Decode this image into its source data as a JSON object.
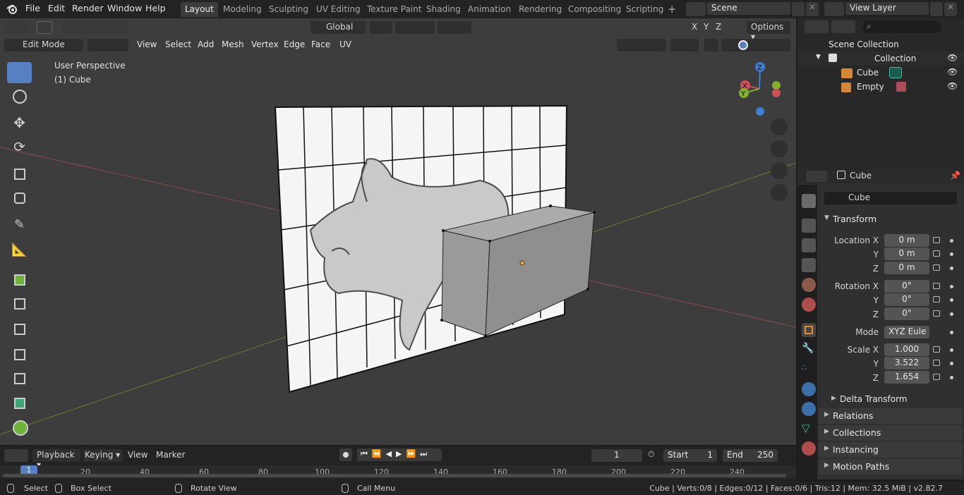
{
  "topbar": {
    "menus": [
      "File",
      "Edit",
      "Render",
      "Window",
      "Help"
    ],
    "workspaces": [
      "Layout",
      "Modeling",
      "Sculpting",
      "UV Editing",
      "Texture Paint",
      "Shading",
      "Animation",
      "Rendering",
      "Compositing",
      "Scripting"
    ],
    "active_workspace": "Layout",
    "add_label": "+",
    "scene": "Scene",
    "view_layer": "View Layer"
  },
  "viewport": {
    "transform_orientation": "Global",
    "options_label": "Options",
    "mode": "Edit Mode",
    "menus": [
      "View",
      "Select",
      "Add",
      "Mesh",
      "Vertex",
      "Edge",
      "Face",
      "UV"
    ],
    "overlay_title": "User Perspective",
    "overlay_object": "(1) Cube",
    "axes": {
      "x": "X",
      "y": "Y",
      "z": "Z"
    }
  },
  "outliner": {
    "root": "Scene Collection",
    "collection": "Collection",
    "items": [
      "Cube",
      "Empty"
    ]
  },
  "properties": {
    "object_name": "Cube",
    "data_name": "Cube",
    "transform": {
      "title": "Transform",
      "location_label": "Location X",
      "location": [
        "0 m",
        "0 m",
        "0 m"
      ],
      "rotation_label": "Rotation X",
      "rotation": [
        "0°",
        "0°",
        "0°"
      ],
      "mode_label": "Mode",
      "mode": "XYZ Eule",
      "scale_label": "Scale X",
      "scale": [
        "1.000",
        "3.522",
        "1.654"
      ],
      "y_label": "Y",
      "z_label": "Z"
    },
    "delta": "Delta Transform",
    "panels": [
      "Relations",
      "Collections",
      "Instancing",
      "Motion Paths"
    ]
  },
  "timeline": {
    "menus": [
      "Playback",
      "Keying",
      "View",
      "Marker"
    ],
    "current_frame": "1",
    "start_label": "Start",
    "start": "1",
    "end_label": "End",
    "end": "250",
    "ticks": [
      "1",
      "20",
      "40",
      "60",
      "80",
      "100",
      "120",
      "140",
      "160",
      "180",
      "200",
      "220",
      "240"
    ]
  },
  "statusbar": {
    "select": "Select",
    "box_select": "Box Select",
    "rotate": "Rotate View",
    "call_menu": "Call Menu",
    "stats": "Cube | Verts:0/8 | Edges:0/12 | Faces:0/6 | Tris:12 | Mem: 32.5 MiB | v2.82.7"
  },
  "colors": {
    "accent": "#5680c2",
    "x_axis": "#d04e57",
    "y_axis": "#80b02c",
    "z_axis": "#3a7fd4",
    "origin": "#f5a623"
  }
}
